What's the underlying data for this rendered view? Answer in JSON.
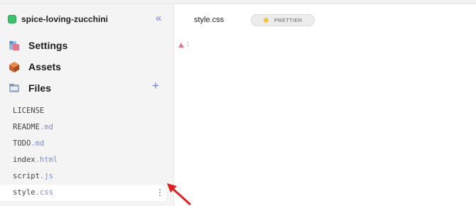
{
  "project": {
    "name": "spice-loving-zucchini",
    "logo_color": "#39c56a",
    "collapse_glyph": "«"
  },
  "nav": {
    "settings_label": "Settings",
    "assets_label": "Assets",
    "files_label": "Files",
    "add_glyph": "+"
  },
  "files": [
    {
      "base": "LICENSE",
      "ext": ""
    },
    {
      "base": "README",
      "ext": ".md"
    },
    {
      "base": "TODO",
      "ext": ".md"
    },
    {
      "base": "index",
      "ext": ".html"
    },
    {
      "base": "script",
      "ext": ".js"
    },
    {
      "base": "style",
      "ext": ".css"
    }
  ],
  "file_menu_glyph": "⋮",
  "editor": {
    "tab_filename": "style.css",
    "prettier_label": "PRETTIER",
    "line_number": "1"
  },
  "colors": {
    "accent": "#6b79d6",
    "annotation_arrow": "#e02020",
    "warning": "#e57a8a"
  },
  "icons": [
    "settings-icon",
    "assets-icon",
    "files-folder-icon",
    "warning-icon",
    "annotation-arrow-icon"
  ]
}
